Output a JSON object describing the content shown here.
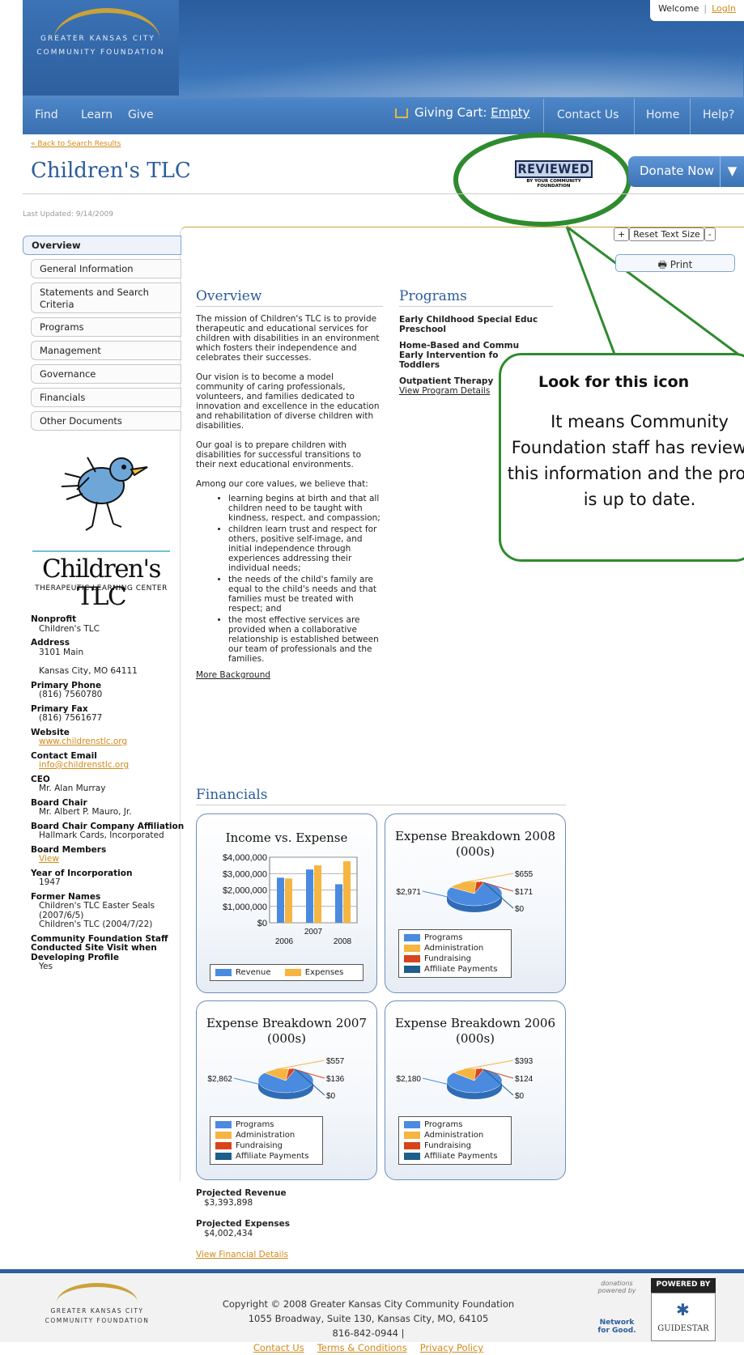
{
  "header": {
    "logo_line1": "GREATER KANSAS CITY",
    "logo_line2": "COMMUNITY FOUNDATION",
    "welcome": "Welcome",
    "login": "LogIn"
  },
  "nav": {
    "find": "Find",
    "learn": "Learn",
    "give": "Give",
    "cart_label": "Giving Cart:",
    "cart_value": "Empty",
    "contact": "Contact Us",
    "home": "Home",
    "help": "Help?"
  },
  "page": {
    "back_link": "« Back to Search Results",
    "title": "Children's TLC",
    "reviewed_big": "REVIEWED",
    "reviewed_small": "BY YOUR COMMUNITY FOUNDATION",
    "donate": "Donate Now",
    "last_updated": "Last Updated: 9/14/2009",
    "text_size_plus": "+",
    "text_size_reset": "Reset Text Size",
    "text_size_minus": "-",
    "print": "Print"
  },
  "sidebar": {
    "tabs": [
      "Overview",
      "General Information",
      "Statements and Search Criteria",
      "Programs",
      "Management",
      "Governance",
      "Financials",
      "Other Documents"
    ]
  },
  "org_logo": {
    "name": "Children's TLC",
    "tagline": "THERAPEUTIC LEARNING CENTER"
  },
  "info": {
    "nonprofit_label": "Nonprofit",
    "nonprofit": "Children's TLC",
    "address_label": "Address",
    "address1": "3101 Main",
    "address2": "Kansas City, MO 64111",
    "phone_label": "Primary Phone",
    "phone": "(816) 7560780",
    "fax_label": "Primary Fax",
    "fax": "(816) 7561677",
    "website_label": "Website",
    "website": "www.childrenstlc.org",
    "email_label": "Contact Email",
    "email": "info@childrenstlc.org",
    "ceo_label": "CEO",
    "ceo": "Mr. Alan Murray",
    "chair_label": "Board Chair",
    "chair": "Mr. Albert P. Mauro, Jr.",
    "chair_company_label": "Board Chair Company Affiliation",
    "chair_company": "Hallmark Cards, Incorporated",
    "members_label": "Board Members",
    "members": "View",
    "year_label": "Year of Incorporation",
    "year": "1947",
    "former_label": "Former Names",
    "former1": "Children's TLC Easter Seals (2007/6/5)",
    "former2": "Children's TLC (2004/7/22)",
    "visit_label": "Community Foundation Staff Conducted Site Visit when Developing Profile",
    "visit": "Yes"
  },
  "overview": {
    "heading": "Overview",
    "p1": "The mission of Children's TLC is to provide therapeutic and educational services for children with disabilities in an environment which fosters their independence and celebrates their successes.",
    "p2": "Our vision is to become a model community of caring professionals, volunteers, and families dedicated to innovation and excellence in the education and rehabilitation of diverse children with disabilities.",
    "p3": "Our goal is to prepare children with disabilities for successful transitions to their next educational environments.",
    "p4": "Among our core values, we believe that:",
    "bullets": [
      "learning begins at birth and that all children need to be taught with kindness, respect, and compassion;",
      "children learn trust and respect for others, positive self-image, and initial independence through experiences addressing their individual needs;",
      "the needs of the child's family are equal to the child's needs and that families must be treated with respect; and",
      "the most effective services are provided when a collaborative relationship is established between our team of professionals and the families."
    ],
    "more": "More Background"
  },
  "programs": {
    "heading": "Programs",
    "items": [
      "Early Childhood Special Educ",
      "Preschool",
      "Home-Based and Commu",
      "Early Intervention fo",
      "Toddlers",
      "Outpatient Therapy"
    ],
    "details": "View Program Details"
  },
  "financials": {
    "heading": "Financials",
    "projected_revenue_label": "Projected Revenue",
    "projected_revenue": "$3,393,898",
    "projected_expenses_label": "Projected Expenses",
    "projected_expenses": "$4,002,434",
    "details_link": "View Financial Details"
  },
  "chart_data": [
    {
      "type": "bar",
      "title": "Income vs. Expense",
      "categories": [
        "2006",
        "2007",
        "2008"
      ],
      "series": [
        {
          "name": "Revenue",
          "values": [
            2750000,
            3250000,
            2350000
          ],
          "color": "#4a8be0"
        },
        {
          "name": "Expenses",
          "values": [
            2700000,
            3500000,
            3750000
          ],
          "color": "#f5b540"
        }
      ],
      "yticks": [
        "$4,000,000",
        "$3,000,000",
        "$2,000,000",
        "$1,000,000",
        "$0"
      ],
      "ylim": [
        0,
        4000000
      ]
    },
    {
      "type": "pie",
      "title": "Expense Breakdown 2008 (000s)",
      "labels": [
        "Programs",
        "Administration",
        "Fundraising",
        "Affiliate Payments"
      ],
      "values": [
        2971,
        655,
        171,
        0
      ],
      "value_labels": [
        "$2,971",
        "$655",
        "$171",
        "$0"
      ]
    },
    {
      "type": "pie",
      "title": "Expense Breakdown 2007 (000s)",
      "labels": [
        "Programs",
        "Administration",
        "Fundraising",
        "Affiliate Payments"
      ],
      "values": [
        2862,
        557,
        136,
        0
      ],
      "value_labels": [
        "$2,862",
        "$557",
        "$136",
        "$0"
      ]
    },
    {
      "type": "pie",
      "title": "Expense Breakdown 2006 (000s)",
      "labels": [
        "Programs",
        "Administration",
        "Fundraising",
        "Affiliate Payments"
      ],
      "values": [
        2180,
        393,
        124,
        0
      ],
      "value_labels": [
        "$2,180",
        "$393",
        "$124",
        "$0"
      ]
    }
  ],
  "legend_colors": [
    "#4a8be0",
    "#f5b540",
    "#d9431c",
    "#1d5f8a"
  ],
  "callout": {
    "heading": "Look for this icon",
    "body": "It means Community Foundation staff has reviewed this information and the profile is up to date."
  },
  "footer": {
    "logo_line1": "GREATER KANSAS CITY",
    "logo_line2": "COMMUNITY FOUNDATION",
    "copyright": "Copyright © 2008 Greater Kansas City Community Foundation",
    "address": "1055 Broadway, Suite 130, Kansas City, MO, 64105",
    "phone": "816-842-0944 |",
    "contact": "Contact Us",
    "terms": "Terms & Conditions",
    "privacy": "Privacy Policy",
    "donations": "donations powered by",
    "network": "Network for Good.",
    "powered": "POWERED BY",
    "guidestar": "GUIDESTAR"
  }
}
